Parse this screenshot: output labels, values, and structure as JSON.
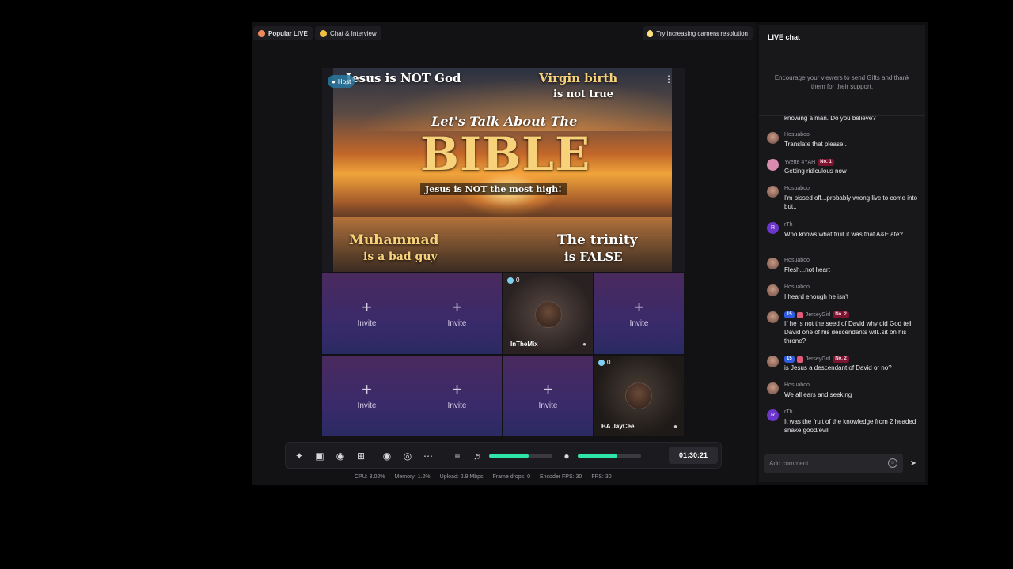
{
  "topbar": {
    "popular_label": "Popular LIVE",
    "chat_interview_label": "Chat & Interview",
    "tip_label": "Try increasing camera resolution"
  },
  "hero": {
    "host_label": "Host",
    "line_top_left": "Jesus is NOT God",
    "line_top_right_1": "Virgin birth",
    "line_top_right_2": "is not true",
    "title_1": "Let's Talk About The",
    "title_2": "BIBLE",
    "subtitle": "Jesus is NOT the most high!",
    "bottom_left_1": "Muhammad",
    "bottom_left_2": "is a bad guy",
    "bottom_right_1": "The trinity",
    "bottom_right_2": "is FALSE"
  },
  "grid": {
    "invite_label": "Invite",
    "guest1": {
      "name": "InTheMix",
      "viewers": "0"
    },
    "guest2": {
      "name": "BA JayCee",
      "viewers": "0"
    }
  },
  "toolbar": {
    "timer": "01:30:21"
  },
  "stats": {
    "cpu": "CPU: 3.02%",
    "memory": "Memory: 1.2%",
    "upload": "Upload: 2.9 Mbps",
    "frame_drops": "Frame drops: 0",
    "encoder_fps": "Encoder FPS: 30",
    "fps": "FPS: 30"
  },
  "chat": {
    "title": "LIVE chat",
    "hint": "Encourage your viewers to send Gifts and thank them for their support.",
    "composer_placeholder": "Add comment",
    "messages": [
      {
        "user": "",
        "text": "knowing a man. Do you believe?"
      },
      {
        "user": "Hosuaboo",
        "text": "Translate that please.."
      },
      {
        "user": "Yvette 4YAH",
        "badge": "No. 1",
        "text": "Getting ridiculous now"
      },
      {
        "user": "Hosuaboo",
        "text": "I'm pissed off...probably wrong live to come into but.."
      },
      {
        "user": "rTh",
        "initial": "R",
        "text": "Who knows what fruit it was that A&E ate?"
      },
      {
        "user": "Hosuaboo",
        "text": "Flesh...not heart"
      },
      {
        "user": "Hosuaboo",
        "text": "I heard enough he isn't"
      },
      {
        "user": "JerseyGirl",
        "level": "15",
        "badge": "No. 2",
        "text": "If he is not the seed of David why did God tell David one of his descendants will..sit on his throne?"
      },
      {
        "user": "JerseyGirl",
        "level": "15",
        "badge": "No. 2",
        "text": "is Jesus a descendant of David or no?"
      },
      {
        "user": "Hosuaboo",
        "text": "We all ears and seeking"
      },
      {
        "user": "rTh",
        "initial": "R",
        "text": "It was the fruit of the knowledge from 2 headed snake good/evil"
      }
    ]
  },
  "colors": {
    "accent": "#2ee6a8",
    "invite_tile": "#3a2a6a",
    "rank_badge": "#7a1430"
  }
}
